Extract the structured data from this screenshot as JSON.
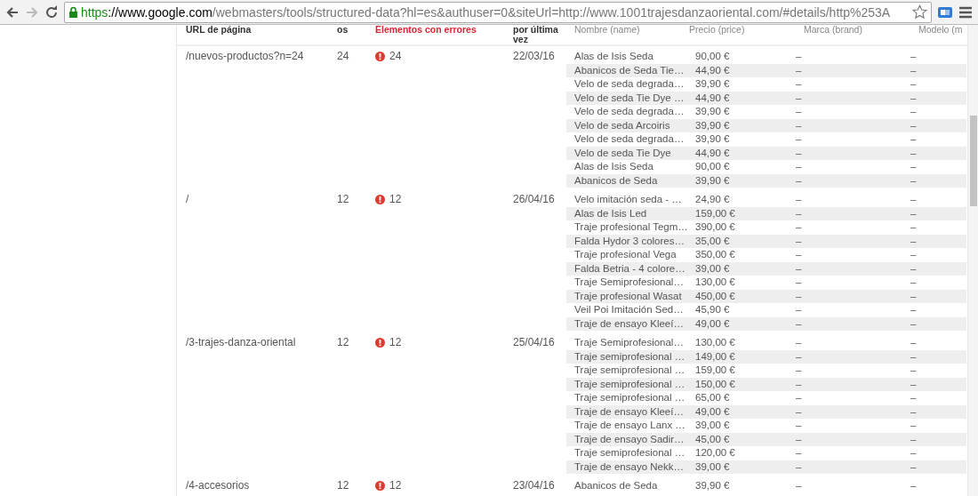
{
  "browser": {
    "address": {
      "scheme": "https",
      "host": "://www.google.com",
      "path": "/webmasters/tools/structured-data?hl=es&authuser=0&siteUrl=http://www.1001trajesdanzaoriental.com/#details/http%253A"
    }
  },
  "table": {
    "columns": [
      {
        "label": "URL de página",
        "kind": "plain"
      },
      {
        "label": "os",
        "kind": "plain"
      },
      {
        "label": "Elementos con errores",
        "kind": "error"
      },
      {
        "label": "por última vez",
        "kind": "plain"
      }
    ],
    "item_columns": [
      "Nombre (name)",
      "Precio (price)",
      "Marca (brand)",
      "Modelo (m"
    ],
    "rows": [
      {
        "url": "/nuevos-productos?n=24",
        "items": "24",
        "errors": "24",
        "date": "22/03/16",
        "products": [
          {
            "name": "Alas de Isis Seda",
            "price": "90,00 €",
            "brand": "–",
            "model": "–"
          },
          {
            "name": "Abanicos de Seda Tie…",
            "price": "44,90 €",
            "brand": "–",
            "model": "–"
          },
          {
            "name": "Velo de seda degrada…",
            "price": "39,90 €",
            "brand": "–",
            "model": "–"
          },
          {
            "name": "Velo de seda Tie Dye …",
            "price": "44,90 €",
            "brand": "–",
            "model": "–"
          },
          {
            "name": "Velo de seda degrada…",
            "price": "39,90 €",
            "brand": "–",
            "model": "–"
          },
          {
            "name": "Velo de seda Arcoiris",
            "price": "39,90 €",
            "brand": "–",
            "model": "–"
          },
          {
            "name": "Velo de seda degrada…",
            "price": "39,90 €",
            "brand": "–",
            "model": "–"
          },
          {
            "name": "Velo de seda Tie Dye",
            "price": "44,90 €",
            "brand": "–",
            "model": "–"
          },
          {
            "name": "Alas de Isis Seda",
            "price": "90,00 €",
            "brand": "–",
            "model": "–"
          },
          {
            "name": "Abanicos de Seda",
            "price": "39,90 €",
            "brand": "–",
            "model": "–"
          }
        ]
      },
      {
        "url": "/",
        "items": "12",
        "errors": "12",
        "date": "26/04/16",
        "products": [
          {
            "name": "Velo imitación seda - …",
            "price": "24,90 €",
            "brand": "–",
            "model": "–"
          },
          {
            "name": "Alas de Isis Led",
            "price": "159,00 €",
            "brand": "–",
            "model": "–"
          },
          {
            "name": "Traje profesional Tegm…",
            "price": "390,00 €",
            "brand": "–",
            "model": "–"
          },
          {
            "name": "Falda Hydor 3 colores…",
            "price": "35,00 €",
            "brand": "–",
            "model": "–"
          },
          {
            "name": "Traje profesional Vega",
            "price": "350,00 €",
            "brand": "–",
            "model": "–"
          },
          {
            "name": "Falda Betria - 4 colore…",
            "price": "39,00 €",
            "brand": "–",
            "model": "–"
          },
          {
            "name": "Traje Semiprofesional…",
            "price": "130,00 €",
            "brand": "–",
            "model": "–"
          },
          {
            "name": "Traje profesional Wasat",
            "price": "450,00 €",
            "brand": "–",
            "model": "–"
          },
          {
            "name": "Veil Poi Imitación Sed…",
            "price": "45,90 €",
            "brand": "–",
            "model": "–"
          },
          {
            "name": "Traje de ensayo Kleeí…",
            "price": "49,00 €",
            "brand": "–",
            "model": "–"
          }
        ]
      },
      {
        "url": "/3-trajes-danza-oriental",
        "items": "12",
        "errors": "12",
        "date": "25/04/16",
        "products": [
          {
            "name": "Traje Semiprofesional…",
            "price": "130,00 €",
            "brand": "–",
            "model": "–"
          },
          {
            "name": "Traje semiprofesional …",
            "price": "149,00 €",
            "brand": "–",
            "model": "–"
          },
          {
            "name": "Traje semiprofesional …",
            "price": "159,00 €",
            "brand": "–",
            "model": "–"
          },
          {
            "name": "Traje semiprofesional …",
            "price": "150,00 €",
            "brand": "–",
            "model": "–"
          },
          {
            "name": "Traje semiprofesional …",
            "price": "65,00 €",
            "brand": "–",
            "model": "–"
          },
          {
            "name": "Traje de ensayo Kleeí…",
            "price": "49,00 €",
            "brand": "–",
            "model": "–"
          },
          {
            "name": "Traje de ensayo Lanx …",
            "price": "39,00 €",
            "brand": "–",
            "model": "–"
          },
          {
            "name": "Traje de ensayo Sadir…",
            "price": "45,00 €",
            "brand": "–",
            "model": "–"
          },
          {
            "name": "Traje semiprofesional …",
            "price": "120,00 €",
            "brand": "–",
            "model": "–"
          },
          {
            "name": "Traje de ensayo Nekk…",
            "price": "39,00 €",
            "brand": "–",
            "model": "–"
          }
        ]
      },
      {
        "url": "/4-accesorios",
        "items": "12",
        "errors": "12",
        "date": "23/04/16",
        "products": [
          {
            "name": "Abanicos de Seda",
            "price": "39,90 €",
            "brand": "–",
            "model": "–"
          }
        ]
      }
    ]
  }
}
